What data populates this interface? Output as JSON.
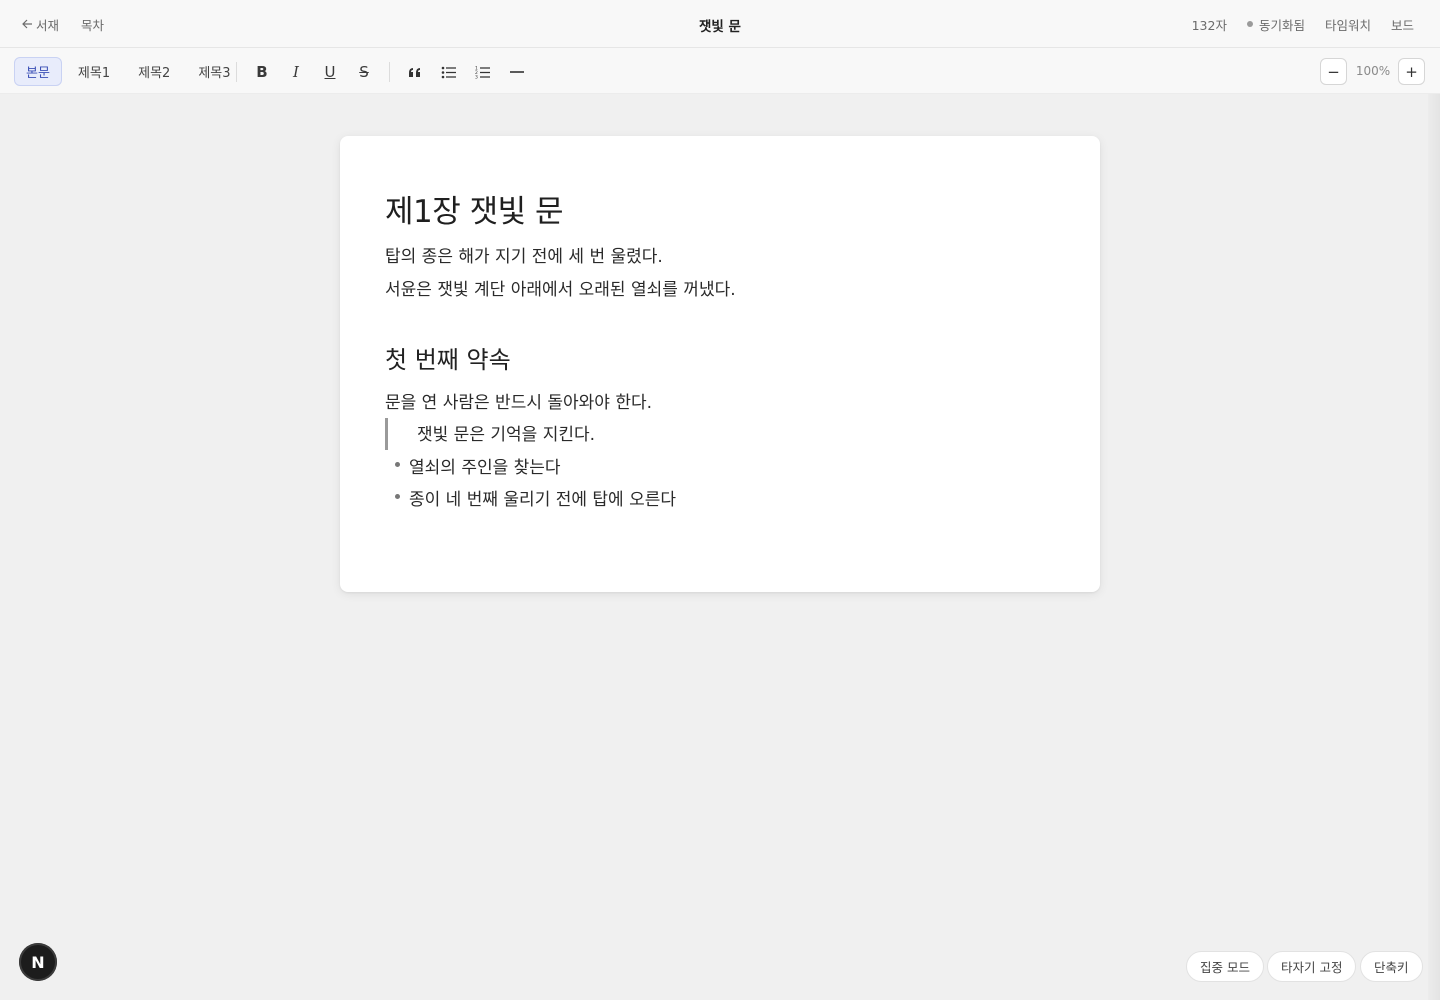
{
  "topbar": {
    "back_label": "서재",
    "toc_label": "목차",
    "doc_title": "잿빛 문",
    "char_count": "132자",
    "sync_status": "동기화됨",
    "typewriter_label": "타임워치",
    "board_label": "보드"
  },
  "toolbar": {
    "styles": [
      "본문",
      "제목1",
      "제목2",
      "제목3"
    ],
    "active_style": "본문",
    "bold_label": "B",
    "italic_label": "I",
    "underline_label": "U",
    "strike_label": "S",
    "zoom_out_label": "−",
    "zoom_value": "100%",
    "zoom_in_label": "+"
  },
  "document": {
    "heading1": "제1장 잿빛 문",
    "para1": "탑의 종은 해가 지기 전에 세 번 울렸다.",
    "para2": "서윤은 잿빛 계단 아래에서 오래된 열쇠를 꺼냈다.",
    "heading2": "첫 번째 약속",
    "para3": "문을 연 사람은 반드시 돌아와야 한다.",
    "quote": "잿빛 문은 기억을 지킨다.",
    "list_items": [
      "열쇠의 주인을 찾는다",
      "종이 네 번째 울리기 전에 탑에 오른다"
    ]
  },
  "avatar_letter": "N",
  "bottom": {
    "focus_mode": "집중 모드",
    "typewriter_fixed": "타자기 고정",
    "shortcuts": "단축키"
  }
}
